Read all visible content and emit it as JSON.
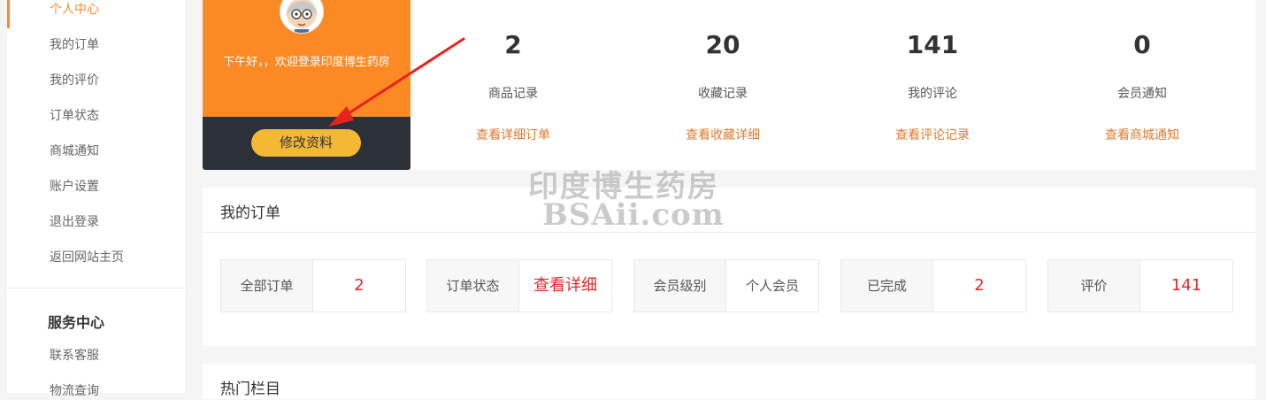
{
  "sidebar": {
    "items": [
      {
        "label": "个人中心",
        "active": true
      },
      {
        "label": "我的订单"
      },
      {
        "label": "我的评价"
      },
      {
        "label": "订单状态"
      },
      {
        "label": "商城通知"
      },
      {
        "label": "账户设置"
      },
      {
        "label": "退出登录"
      },
      {
        "label": "返回网站主页"
      }
    ],
    "service_title": "服务中心",
    "service_items": [
      {
        "label": "联系客服"
      },
      {
        "label": "物流查询"
      }
    ]
  },
  "profile": {
    "greeting": "下午好，，欢迎登录印度博生药房",
    "edit_button": "修改资料",
    "avatar_icon": "cartoon-avatar-icon"
  },
  "stats": [
    {
      "value": "2",
      "label": "商品记录",
      "link": "查看详细订单"
    },
    {
      "value": "20",
      "label": "收藏记录",
      "link": "查看收藏详细"
    },
    {
      "value": "141",
      "label": "我的评论",
      "link": "查看评论记录"
    },
    {
      "value": "0",
      "label": "会员通知",
      "link": "查看商城通知"
    }
  ],
  "watermark": {
    "line1": "印度博生药房",
    "line2": "BSAii.com"
  },
  "orders": {
    "title": "我的订单",
    "cells": [
      {
        "label": "全部订单",
        "value": "2"
      },
      {
        "label": "订单状态",
        "value": "查看详细"
      },
      {
        "label": "会员级别",
        "value": "个人会员"
      },
      {
        "label": "已完成",
        "value": "2"
      },
      {
        "label": "评价",
        "value": "141"
      }
    ]
  },
  "hot": {
    "title": "热门栏目"
  },
  "colors": {
    "accent": "#fb8a24",
    "dark": "#2c3038",
    "button": "#f3b935",
    "link": "#e2792b",
    "value_red": "#e0272a",
    "annotation_arrow": "#e8231d"
  }
}
